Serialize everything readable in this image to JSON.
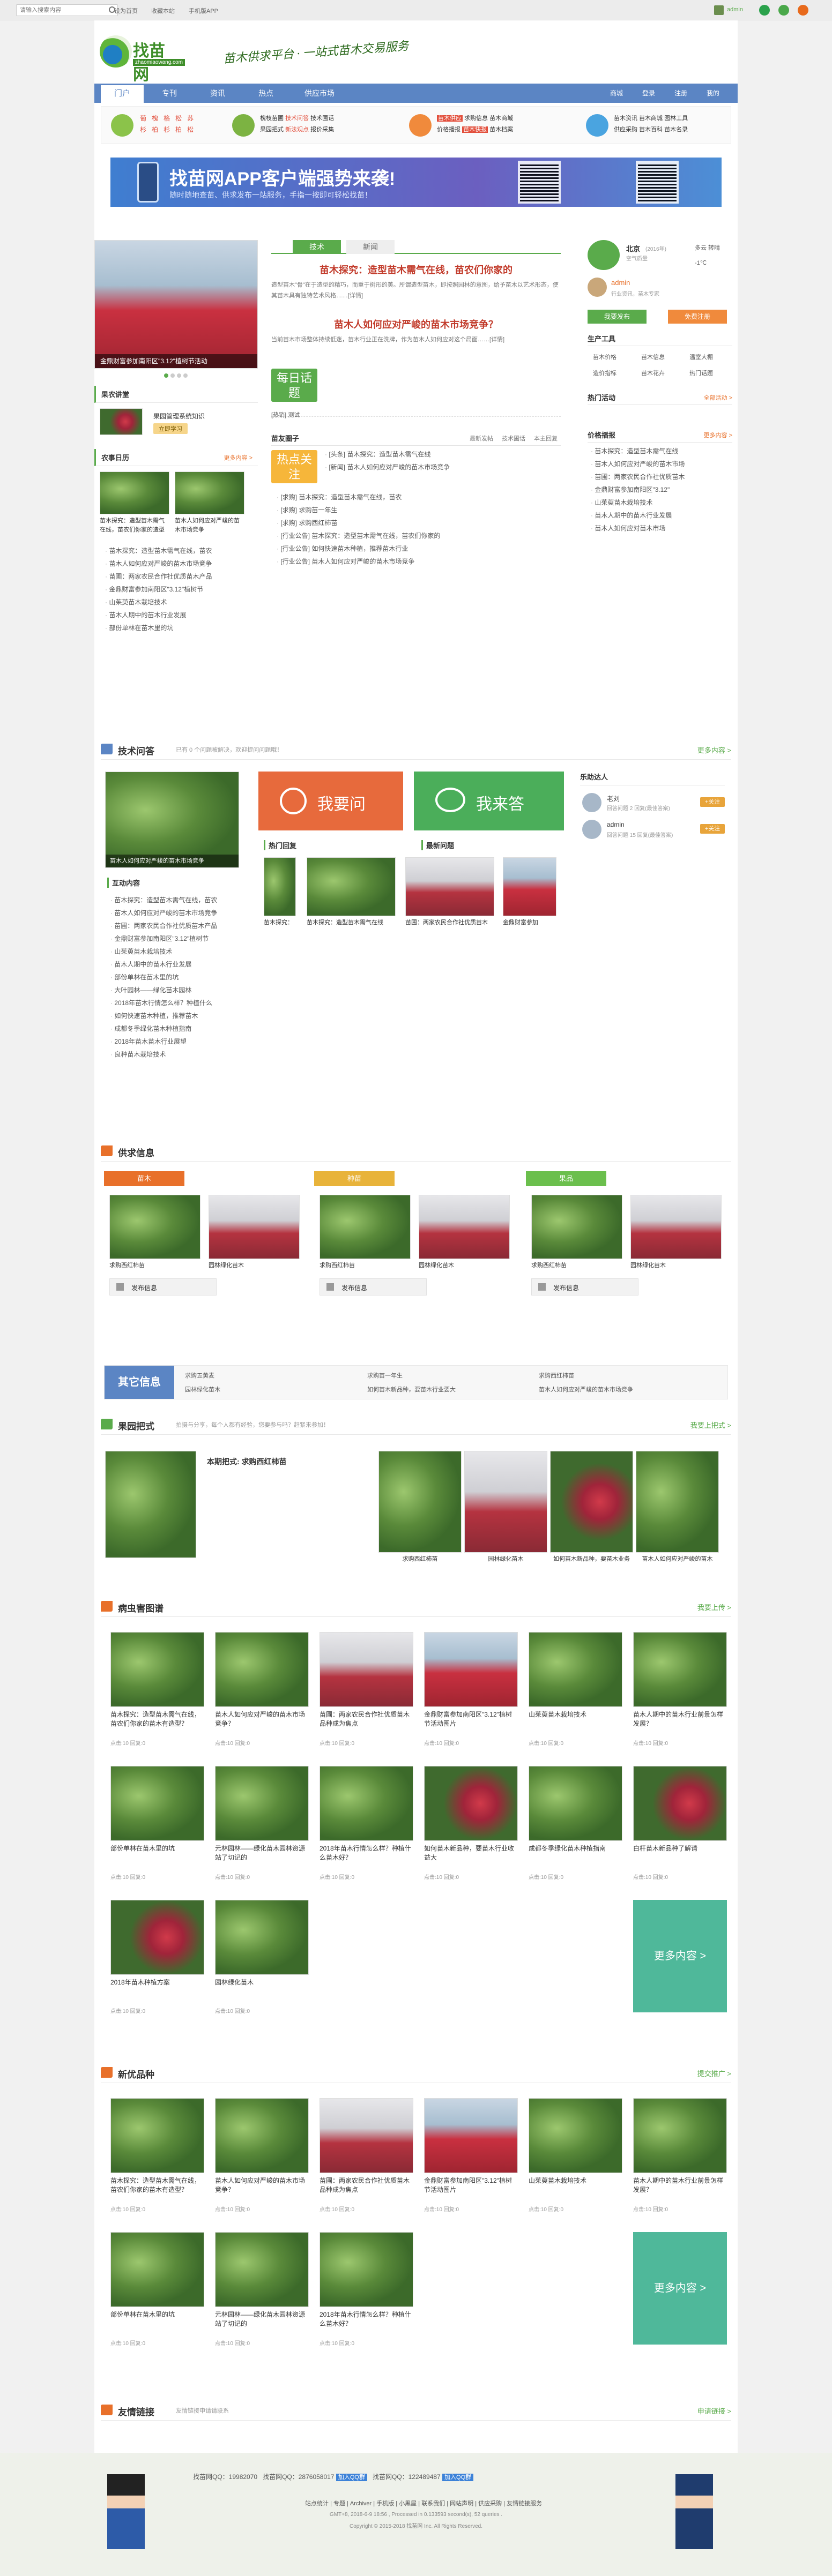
{
  "topbar": {
    "search_placeholder": "请输入搜索内容",
    "links": [
      "设为首页",
      "收藏本站",
      "手机版APP"
    ],
    "user": "admin"
  },
  "header": {
    "logo_text": "找苗网",
    "logo_sub": "zhaomiaowang.com",
    "slogan": "苗木供求平台 · 一站式苗木交易服务"
  },
  "nav": {
    "items": [
      "门户",
      "专刊",
      "资讯",
      "热点",
      "供应市场"
    ],
    "right": [
      "商城",
      "登录",
      "注册",
      "我的"
    ]
  },
  "quicklinks": {
    "g1": [
      "葡",
      "槐",
      "格",
      "松",
      "苏",
      "杉",
      "柏",
      "杉",
      "柏",
      "松"
    ],
    "g2": [
      "槐枝苗圃",
      "技术问答",
      "技术圃话",
      "果园把式",
      "新法观点",
      "报价采集"
    ],
    "g3": [
      "苗木供应",
      "求购信息",
      "苗木商城",
      "价格播报",
      "苗木快报",
      "苗木档案"
    ],
    "g4": [
      "苗木资讯",
      "苗木商城",
      "园林工具",
      "供应采购",
      "苗木百科",
      "苗木名录"
    ]
  },
  "app_banner": {
    "title": "找苗网APP客户端强势来袭!",
    "sub": "随时随地查苗、供求发布一站服务，手指一按即可轻松找苗！"
  },
  "slider": {
    "caption": "金鼎财富参加南阳区\"3.12\"植树节活动"
  },
  "news_tabs": [
    "技术",
    "新闻"
  ],
  "headline1": "苗木探究：造型苗木需气在线，苗农们你家的",
  "headline1_desc": "造型苗木\"骨\"在于造型的精巧，而重于树形的美。所谓造型苗木，即按照园林的意图，给予苗木以艺术形态，使其苗木具有独特艺术风格……[详情]",
  "headline2": "苗木人如何应对严峻的苗木市场竞争？",
  "headline2_desc": "当前苗木市场整体持续低迷，苗木行业正在洗牌，作为苗木人如何应对这个局面……[详情]",
  "topic": {
    "label": "每日话题",
    "tag": "[热销]",
    "title": "测试"
  },
  "focus": {
    "label": "热点关注",
    "items": [
      "[头条] 苗木探究：造型苗木需气在线",
      "[新闻] 苗木人如何应对严峻的苗木市场竞争",
      "[资讯] 苗木探究：造型苗木需气在线",
      "[资讯] 苗木人如何应对严峻的苗木市场竞争"
    ]
  },
  "weather": {
    "city": "北京",
    "date": "(2016年)",
    "temp": "多云 转晴",
    "air": "空气质量",
    "range": "-1℃",
    "name": "admin",
    "desc": "行业资讯，苗木专家"
  },
  "user_buttons": {
    "publish": "我要发布",
    "reg": "免费注册"
  },
  "side_tools": {
    "title": "生产工具",
    "items": [
      "苗木价格",
      "苗木信息",
      "温室大棚",
      "造价指标",
      "苗木花卉",
      "热门话题"
    ]
  },
  "hot_activity": {
    "title": "热门活动",
    "more": "全部活动 >"
  },
  "price_report": {
    "title": "价格播报",
    "more": "更多内容 >",
    "items": [
      "苗木探究：造型苗木需气在线",
      "苗木人如何应对严峻的苗木市场",
      "苗圃：两家农民合作社优质苗木",
      "金鼎财富参加南阳区\"3.12\"",
      "山茱萸苗木栽培技术",
      "苗木人期中的苗木行业发展",
      "苗木人如何应对苗木市场"
    ]
  },
  "course": {
    "title": "果农讲堂",
    "item": "果园管理系统知识",
    "btn": "立即学习"
  },
  "calendar": {
    "title": "农事日历",
    "more": "更多内容 >",
    "t1": "苗木探究：造型苗木需气在线，苗农们你家的造型",
    "t2": "苗木人如何应对严峻的苗木市场竞争"
  },
  "calendar_list": [
    "苗木探究：造型苗木需气在线，苗农",
    "苗木人如何应对严峻的苗木市场竞争",
    "苗圃：两家农民合作社优质苗木产品",
    "金鼎财富参加南阳区\"3.12\"植树节",
    "山茱萸苗木栽培技术",
    "苗木人期中的苗木行业发展",
    "部份单林在苗木里的坑"
  ],
  "gossip": {
    "title": "苗友圈子",
    "tabs": [
      "最新发帖",
      "技术圃话",
      "本主回复"
    ],
    "items": [
      "[求购] 苗木探究：造型苗木需气在线，苗农",
      "[求购] 求购苗一年生",
      "[求购] 求购西红柿苗",
      "[行业公告] 苗木探究：造型苗木需气在线，苗农们你家的",
      "[行业公告] 如何快速苗木种植，推荐苗木行业",
      "[行业公告] 苗木人如何应对严峻的苗木市场竞争"
    ]
  },
  "qa": {
    "title": "技术问答",
    "sub": "已有 0 个问题被解决，欢迎提问问题哦！",
    "more": "更多内容 >",
    "ask": "我要问",
    "answer": "我来答",
    "image_caption": "苗木人如何应对严峻的苗木市场竞争",
    "activity_title": "互动内容",
    "hot_reply": "热门回复",
    "new_q": "最新问题",
    "list": [
      "苗木探究：造型苗木需气在线，苗农",
      "苗木人如何应对严峻的苗木市场竞争",
      "苗圃：两家农民合作社优质苗木产品",
      "金鼎财富参加南阳区\"3.12\"植树节",
      "山茱萸苗木栽培技术",
      "苗木人期中的苗木行业发展",
      "部份单林在苗木里的坑",
      "大叶园林——绿化苗木园林",
      "2018年苗木行情怎么样？种植什么",
      "如何快速苗木种植，推荐苗木",
      "成都冬季绿化苗木种植指南",
      "2018年苗木苗木行业展望",
      "良种苗木栽培技术"
    ],
    "hot": [
      "苗木探究：造型苗木需气在线",
      "苗木探究：造型苗木需气在线",
      "苗圃：两家农民合作社优质苗木",
      "金鼎财富参加"
    ],
    "experts_title": "乐助达人",
    "experts": [
      {
        "name": "老刘",
        "meta": "回答问题 2 回复(最佳答案)",
        "btn": "+关注"
      },
      {
        "name": "admin",
        "meta": "回答问题 15 回复(最佳答案)",
        "btn": "+关注"
      }
    ]
  },
  "supply": {
    "title": "供求信息",
    "cols": [
      {
        "tab": "苗木",
        "c1": "求购西红柿苗",
        "c2": "园林绿化苗木"
      },
      {
        "tab": "种苗",
        "c1": "求购西红柿苗",
        "c2": "园林绿化苗木"
      },
      {
        "tab": "果品",
        "c1": "求购西红柿苗",
        "c2": "园林绿化苗木"
      }
    ],
    "post": "发布信息",
    "other": "其它信息",
    "other_list": [
      "求购五黄麦",
      "求购苗一年生",
      "求购西红柿苗",
      "园林绿化苗木",
      "如何苗木新品种，要苗木行业要大",
      "苗木人如何应对严峻的苗木市场竞争"
    ]
  },
  "orchard": {
    "title": "果园把式",
    "sub": "拍摄与分享，每个人都有经验，您要参与吗？赶紧来参加！",
    "more": "我要上把式 >",
    "main_title": "本期把式: 求购西红柿苗",
    "items": [
      "求购西红柿苗",
      "园林绿化苗木",
      "如何苗木新品种，要苗木业务",
      "苗木人如何应对严峻的苗木"
    ]
  },
  "album": {
    "title": "病虫害图谱",
    "more": "我要上传 >",
    "items": [
      "苗木探究：造型苗木需气在线，苗农们你家的苗木有造型？",
      "苗木人如何应对严峻的苗木市场竞争？",
      "苗圃：两家农民合作社优质苗木品种成为焦点",
      "金鼎财富参加南阳区\"3.12\"植树节活动图片",
      "山茱萸苗木栽培技术",
      "苗木人期中的苗木行业前景怎样发展？",
      "部份单林在苗木里的坑",
      "元林园林——绿化苗木园林资源站了切记的",
      "2018年苗木行情怎么样？种植什么苗木好？",
      "如何苗木新品种，要苗木行业收益大",
      "成都冬季绿化苗木种植指南",
      "白杆苗木新品种了解请",
      "2018年苗木种植方案",
      "园林绿化苗木"
    ],
    "meta": "点击:10 回复:0",
    "more_btn": "更多内容 >"
  },
  "varieties": {
    "title": "新优品种",
    "more": "提交推广 >",
    "items": [
      "苗木探究：造型苗木需气在线，苗农们你家的苗木有造型？",
      "苗木人如何应对严峻的苗木市场竞争？",
      "苗圃：两家农民合作社优质苗木品种成为焦点",
      "金鼎财富参加南阳区\"3.12\"植树节活动图片",
      "山茱萸苗木栽培技术",
      "苗木人期中的苗木行业前景怎样发展？",
      "部份单林在苗木里的坑",
      "元林园林——绿化苗木园林资源站了切记的",
      "2018年苗木行情怎么样？种植什么苗木好？"
    ],
    "meta": "点击:10 回复:0",
    "more_btn": "更多内容 >"
  },
  "links": {
    "title": "友情链接",
    "sub": "友情链接申请请联系",
    "more": "申请链接 >"
  },
  "footer": {
    "qq_lines": [
      "找苗网QQ：19982070",
      "找苗网QQ：2876058017",
      "找苗网QQ：122489487"
    ],
    "qq_btn": "加入QQ群",
    "nav": [
      "站点统计",
      "专题",
      "Archiver",
      "手机版",
      "小黑屋",
      "联系我们",
      "网站声明",
      "供应采购",
      "友情链接服务"
    ],
    "info": "GMT+8, 2018-6-9 18:56 , Processed in 0.133593 second(s), 52 queries .",
    "copy": "Copyright © 2015-2018 找苗网 Inc. All Rights Reserved."
  }
}
